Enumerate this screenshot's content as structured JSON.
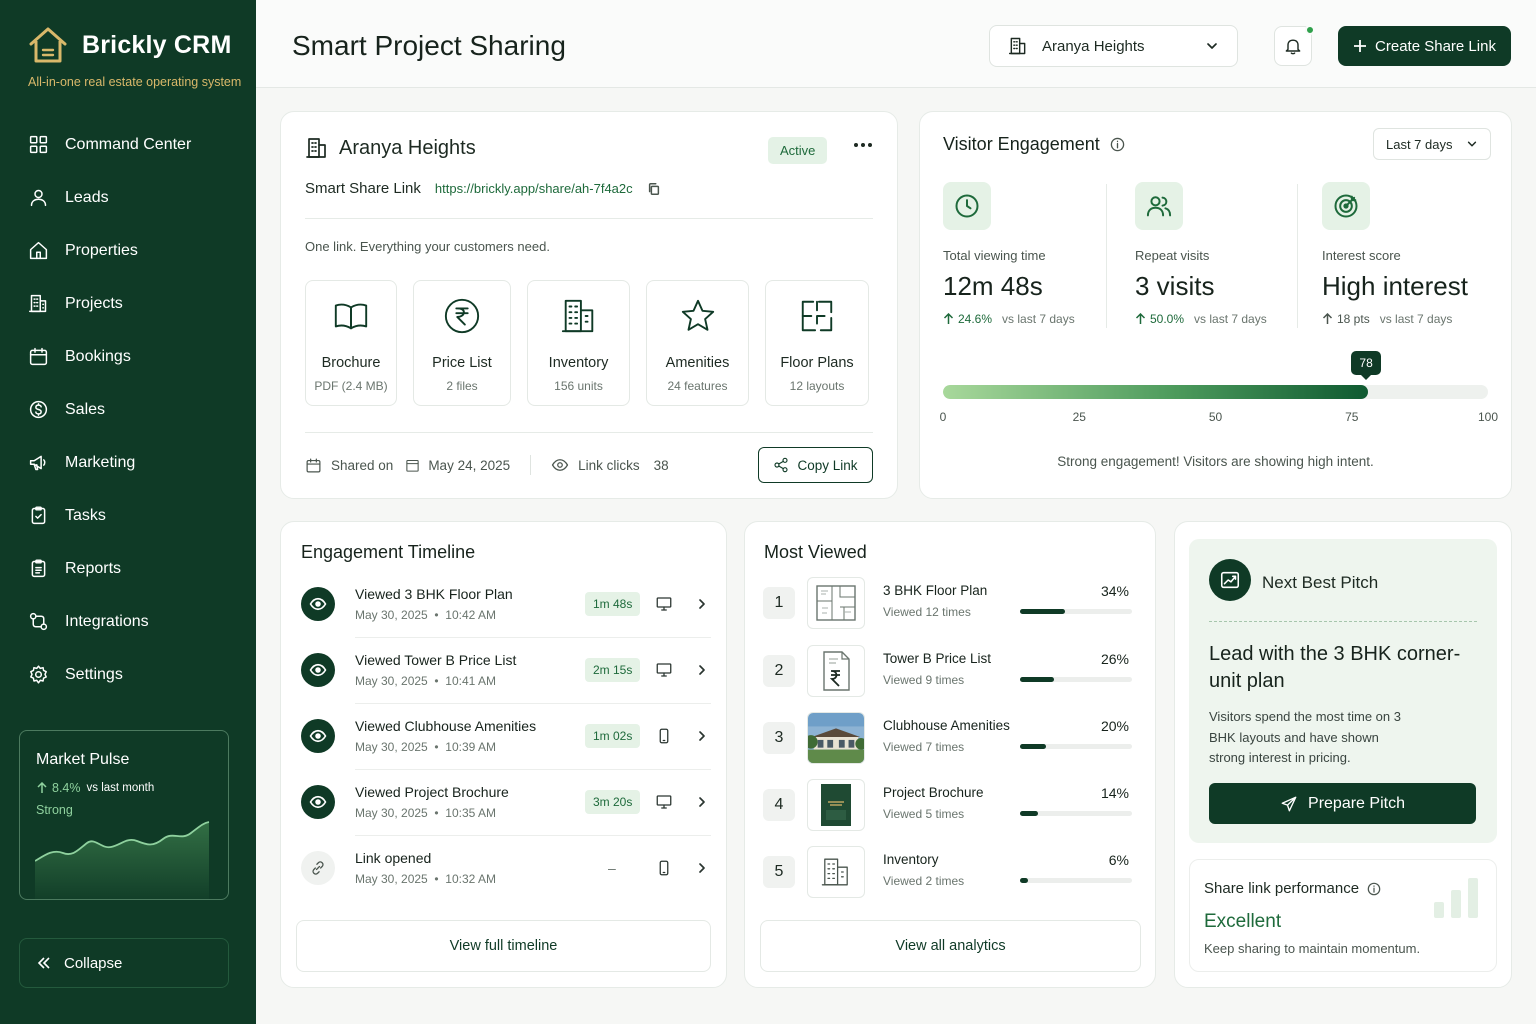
{
  "sidebar": {
    "brand": "Brickly CRM",
    "tagline": "All-in-one real estate operating system",
    "items": [
      {
        "label": "Command Center",
        "icon": "grid-icon"
      },
      {
        "label": "Leads",
        "icon": "user-icon"
      },
      {
        "label": "Properties",
        "icon": "home-icon"
      },
      {
        "label": "Projects",
        "icon": "building-icon"
      },
      {
        "label": "Bookings",
        "icon": "calendar-icon"
      },
      {
        "label": "Sales",
        "icon": "dollar-icon"
      },
      {
        "label": "Marketing",
        "icon": "megaphone-icon"
      },
      {
        "label": "Tasks",
        "icon": "clipboard-icon"
      },
      {
        "label": "Reports",
        "icon": "report-icon"
      },
      {
        "label": "Integrations",
        "icon": "integrations-icon"
      },
      {
        "label": "Settings",
        "icon": "gear-icon"
      }
    ],
    "market_pulse": {
      "title": "Market Pulse",
      "change": "8.4%",
      "vs": "vs last month",
      "status": "Strong"
    },
    "collapse_label": "Collapse"
  },
  "header": {
    "title": "Smart Project Sharing",
    "project_select": "Aranya Heights",
    "create_button": "Create Share Link"
  },
  "project": {
    "name": "Aranya Heights",
    "status": "Active",
    "share_label": "Smart Share Link",
    "share_url": "https://brickly.app/share/ah-7f4a2c",
    "subtitle": "One link. Everything your customers need.",
    "tiles": [
      {
        "label": "Brochure",
        "sub": "PDF (2.4 MB)",
        "icon": "book-icon"
      },
      {
        "label": "Price List",
        "sub": "2 files",
        "icon": "rupee-icon"
      },
      {
        "label": "Inventory",
        "sub": "156 units",
        "icon": "building-icon"
      },
      {
        "label": "Amenities",
        "sub": "24 features",
        "icon": "star-icon"
      },
      {
        "label": "Floor Plans",
        "sub": "12 layouts",
        "icon": "floorplan-icon"
      }
    ],
    "shared_on_label": "Shared on",
    "shared_date": "May 24, 2025",
    "clicks_label": "Link clicks",
    "clicks": "38",
    "copy_button": "Copy Link"
  },
  "engagement": {
    "title": "Visitor Engagement",
    "range": "Last 7 days",
    "metrics": [
      {
        "label": "Total viewing time",
        "value": "12m 48s",
        "delta": "24.6%",
        "vs": "vs last 7 days",
        "icon": "clock-icon"
      },
      {
        "label": "Repeat visits",
        "value": "3 visits",
        "delta": "50.0%",
        "vs": "vs last 7 days",
        "icon": "users-icon"
      },
      {
        "label": "Interest score",
        "value": "High interest",
        "delta": "18 pts",
        "vs": "vs last 7 days",
        "icon": "target-icon"
      }
    ],
    "score": 78,
    "score_label": "78",
    "scale_min": 0,
    "scale_max": 100,
    "ticks": [
      "0",
      "25",
      "50",
      "75",
      "100"
    ],
    "note": "Strong engagement! Visitors are showing high intent."
  },
  "timeline": {
    "title": "Engagement Timeline",
    "items": [
      {
        "title": "Viewed 3 BHK Floor Plan",
        "date": "May 30, 2025",
        "time": "10:42 AM",
        "duration": "1m 48s",
        "device": "desktop-icon"
      },
      {
        "title": "Viewed Tower B Price List",
        "date": "May 30, 2025",
        "time": "10:41 AM",
        "duration": "2m 15s",
        "device": "desktop-icon"
      },
      {
        "title": "Viewed Clubhouse Amenities",
        "date": "May 30, 2025",
        "time": "10:39 AM",
        "duration": "1m 02s",
        "device": "mobile-icon"
      },
      {
        "title": "Viewed Project Brochure",
        "date": "May 30, 2025",
        "time": "10:35 AM",
        "duration": "3m 20s",
        "device": "desktop-icon"
      },
      {
        "title": "Link opened",
        "date": "May 30, 2025",
        "time": "10:32 AM",
        "duration": "–",
        "device": "mobile-icon"
      }
    ],
    "button": "View full timeline"
  },
  "most_viewed": {
    "title": "Most Viewed",
    "items": [
      {
        "rank": "1",
        "name": "3 BHK Floor Plan",
        "sub": "Viewed 12 times",
        "pct": "34%",
        "share": 0.34,
        "thumb": "floorplan-thumb"
      },
      {
        "rank": "2",
        "name": "Tower B Price List",
        "sub": "Viewed 9 times",
        "pct": "26%",
        "share": 0.26,
        "thumb": "pricelist-thumb"
      },
      {
        "rank": "3",
        "name": "Clubhouse Amenities",
        "sub": "Viewed 7 times",
        "pct": "20%",
        "share": 0.2,
        "thumb": "clubhouse-photo"
      },
      {
        "rank": "4",
        "name": "Project Brochure",
        "sub": "Viewed 5 times",
        "pct": "14%",
        "share": 0.14,
        "thumb": "brochure-thumb"
      },
      {
        "rank": "5",
        "name": "Inventory",
        "sub": "Viewed 2 times",
        "pct": "6%",
        "share": 0.06,
        "thumb": "inventory-thumb"
      }
    ],
    "button": "View all analytics"
  },
  "pitch": {
    "label": "Next Best Pitch",
    "headline": "Lead with the 3 BHK corner-unit plan",
    "body": "Visitors spend the most time on 3 BHK layouts and have shown strong interest in pricing.",
    "button": "Prepare Pitch"
  },
  "performance": {
    "title": "Share link performance",
    "value": "Excellent",
    "sub": "Keep sharing to maintain momentum."
  },
  "colors": {
    "brand_dark": "#0f3a26",
    "accent_green": "#1e6a3b",
    "light_green": "#e5f2e6",
    "gold": "#d9b86a"
  }
}
